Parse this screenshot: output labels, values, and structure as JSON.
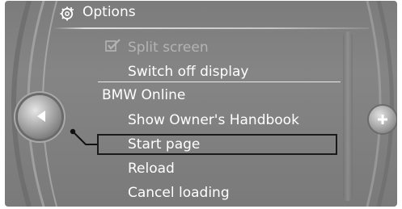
{
  "header": {
    "title": "Options",
    "icon": "gear-settings-icon"
  },
  "menu": {
    "items": [
      {
        "label": "Split screen",
        "state": "disabled",
        "icon": "checkbox-checked-icon"
      },
      {
        "label": "Switch off display"
      },
      {
        "label": "BMW Online",
        "type": "section-header"
      },
      {
        "label": "Show Owner's Handbook"
      },
      {
        "label": "Start page",
        "selected": true
      },
      {
        "label": "Reload"
      },
      {
        "label": "Cancel loading"
      }
    ]
  },
  "controls": {
    "left_knob_icon": "left-arrow-icon",
    "right_knob_icon": "plus-icon"
  },
  "colors": {
    "background": "#808080",
    "text": "#ffffff",
    "disabled_text": "#b4b4b4",
    "selection_border": "#1a1a1a"
  }
}
